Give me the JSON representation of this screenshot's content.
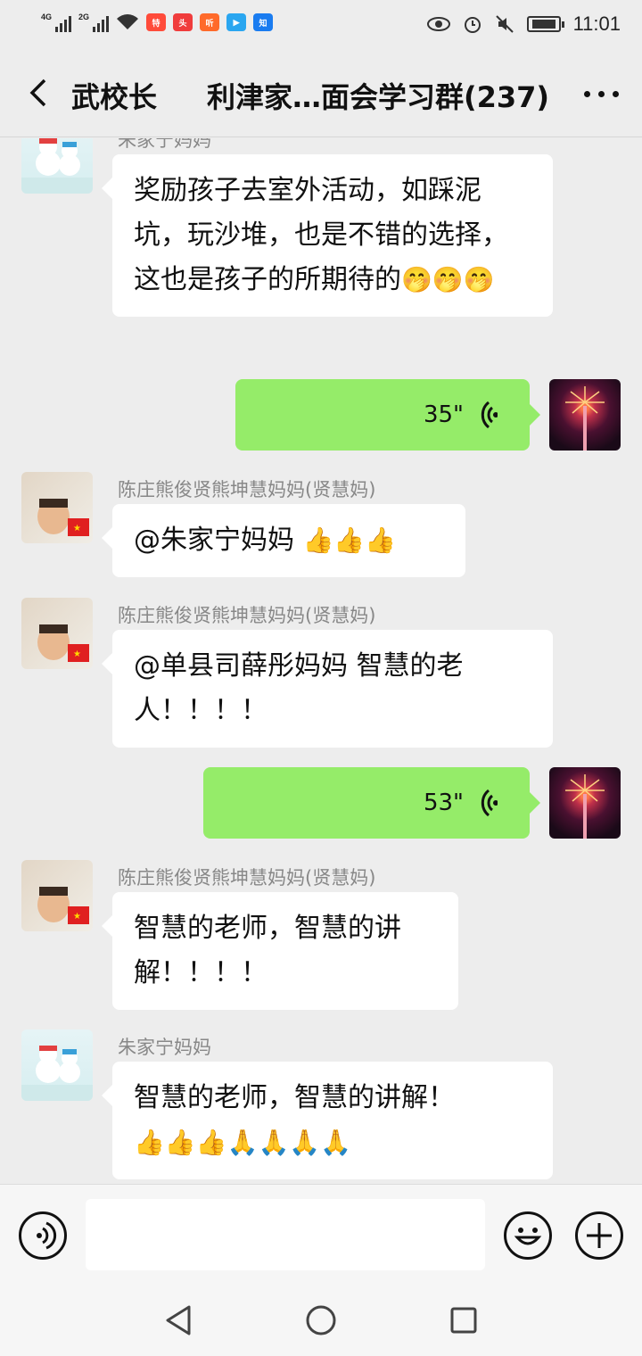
{
  "status_bar": {
    "signal_1": "4G",
    "signal_2": "2G",
    "app_icons": [
      {
        "name": "特价",
        "color": "#ff4b3a"
      },
      {
        "name": "头条",
        "color": "#f03c3c"
      },
      {
        "name": "听",
        "color": "#ff6a2a"
      },
      {
        "name": "视",
        "color": "#2aa6f0"
      },
      {
        "name": "知乎",
        "color": "#1a7cf0"
      }
    ],
    "time": "11:01"
  },
  "header": {
    "back_label": "武校长",
    "title": "利津家…面会学习群(237)"
  },
  "messages": [
    {
      "sender": "朱家宁妈妈",
      "text": "奖励孩子去室外活动，如踩泥坑，玩沙堆，也是不错的选择，这也是孩子的所期待的",
      "emojis": "🤭🤭🤭"
    },
    {
      "duration": "35\""
    },
    {
      "sender": "陈庄熊俊贤熊坤慧妈妈(贤慧妈)",
      "text": "@朱家宁妈妈 ",
      "emojis": "👍👍👍"
    },
    {
      "sender": "陈庄熊俊贤熊坤慧妈妈(贤慧妈)",
      "text": "@单县司薛彤妈妈  智慧的老人！！！！"
    },
    {
      "duration": "53\""
    },
    {
      "sender": "陈庄熊俊贤熊坤慧妈妈(贤慧妈)",
      "text": "智慧的老师，智慧的讲解！！！！"
    },
    {
      "sender": "朱家宁妈妈",
      "text": "智慧的老师，智慧的讲解！",
      "emojis": "👍👍👍🙏🙏🙏🙏"
    }
  ],
  "colors": {
    "background": "#ededed",
    "own_bubble": "#95ec69",
    "other_bubble": "#ffffff",
    "sender_name": "#888888"
  }
}
